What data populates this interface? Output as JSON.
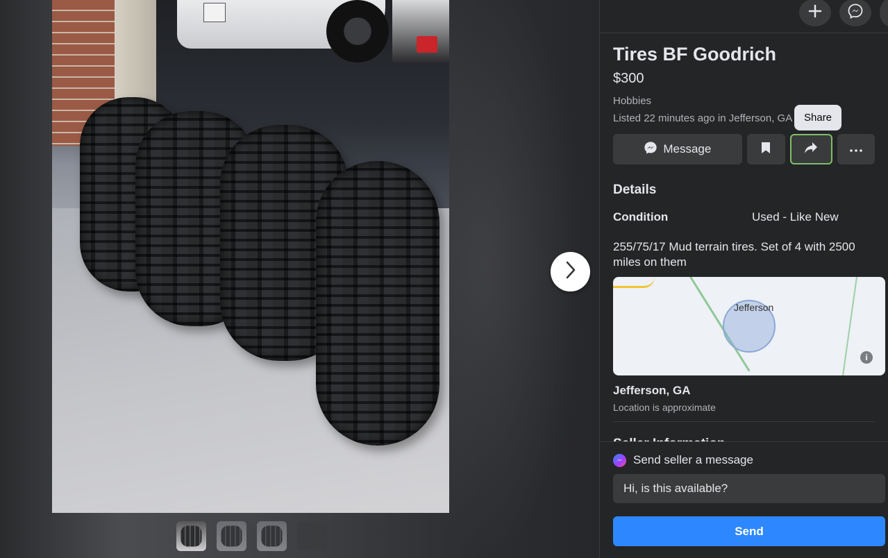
{
  "listing": {
    "title": "Tires BF Goodrich",
    "price": "$300",
    "category": "Hobbies",
    "listed": "Listed 22 minutes ago in Jefferson, GA"
  },
  "actions": {
    "message_label": "Message",
    "share_tooltip": "Share",
    "icons": [
      "messenger-icon",
      "bookmark-icon",
      "share-arrow-icon",
      "more-icon"
    ]
  },
  "topbar": {
    "icons": [
      "plus-icon",
      "messenger-icon"
    ]
  },
  "details": {
    "heading": "Details",
    "condition_label": "Condition",
    "condition_value": "Used - Like New",
    "description": "255/75/17 Mud terrain tires. Set of 4 with 2500 miles on them"
  },
  "map": {
    "label": "Jefferson",
    "info": "i"
  },
  "location": {
    "title": "Jefferson, GA",
    "subtitle": "Location is approximate"
  },
  "seller": {
    "heading": "Seller Information"
  },
  "messaging": {
    "label": "Send seller a message",
    "input_value": "Hi, is this available?",
    "send_label": "Send"
  },
  "viewer": {
    "thumbnail_count": 4,
    "active_thumbnail": 1
  },
  "colors": {
    "accent": "#2d88ff",
    "panel": "#242526",
    "button": "#3a3b3c"
  }
}
